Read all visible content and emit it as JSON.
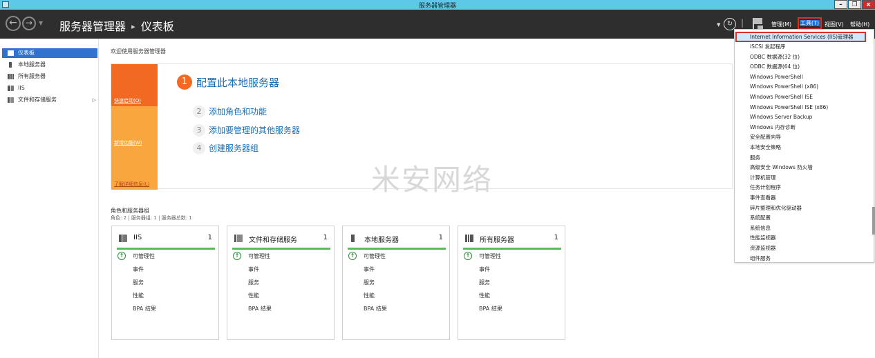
{
  "window": {
    "title": "服务器管理器",
    "min_glyph": "–",
    "max_glyph": "❐",
    "close_glyph": "x"
  },
  "header": {
    "back_glyph": "←",
    "forward_glyph": "→",
    "dropdown_glyph": "▼",
    "breadcrumb_root": "服务器管理器",
    "breadcrumb_sep": "▸",
    "breadcrumb_current": "仪表板",
    "refresh_glyph": "↻",
    "separator": "|",
    "menus": {
      "manage": "管理(M)",
      "tools": "工具(T)",
      "view": "视图(V)",
      "help": "帮助(H)"
    }
  },
  "sidebar": {
    "items": [
      {
        "label": "仪表板",
        "icon": "dashboard-grid-icon",
        "selected": true
      },
      {
        "label": "本地服务器",
        "icon": "server-icon"
      },
      {
        "label": "所有服务器",
        "icon": "servers-icon"
      },
      {
        "label": "IIS",
        "icon": "iis-icon"
      },
      {
        "label": "文件和存储服务",
        "icon": "file-storage-icon",
        "arrow": "▷"
      }
    ]
  },
  "main": {
    "welcome": "欢迎使用服务器管理器",
    "quickstart": {
      "tiles": [
        "快速启动(Q)",
        "新增功能(W)",
        "了解详细信息(L)"
      ],
      "steps": [
        {
          "num": "1",
          "label": "配置此本地服务器"
        },
        {
          "num": "2",
          "label": "添加角色和功能"
        },
        {
          "num": "3",
          "label": "添加要管理的其他服务器"
        },
        {
          "num": "4",
          "label": "创建服务器组"
        }
      ]
    },
    "watermark": "米安网络",
    "roles": {
      "title": "角色和服务器组",
      "subtitle": "角色: 2 | 服务器组: 1 | 服务器总数: 1",
      "cards": [
        {
          "title": "IIS",
          "count": "1",
          "ok_glyph": "↑",
          "lines": [
            "可管理性",
            "事件",
            "服务",
            "性能",
            "BPA 结果"
          ]
        },
        {
          "title": "文件和存储服务",
          "count": "1",
          "ok_glyph": "↑",
          "lines": [
            "可管理性",
            "事件",
            "服务",
            "性能",
            "BPA 结果"
          ]
        },
        {
          "title": "本地服务器",
          "count": "1",
          "ok_glyph": "↑",
          "lines": [
            "可管理性",
            "事件",
            "服务",
            "性能",
            "BPA 结果"
          ]
        },
        {
          "title": "所有服务器",
          "count": "1",
          "ok_glyph": "↑",
          "lines": [
            "可管理性",
            "事件",
            "服务",
            "性能",
            "BPA 结果"
          ]
        }
      ]
    }
  },
  "tools_menu": {
    "items": [
      "Internet Information Services (IIS)管理器",
      "iSCSI 发起程序",
      "ODBC 数据源(32 位)",
      "ODBC 数据源(64 位)",
      "Windows PowerShell",
      "Windows PowerShell (x86)",
      "Windows PowerShell ISE",
      "Windows PowerShell ISE (x86)",
      "Windows Server Backup",
      "Windows 内存诊断",
      "安全配置向导",
      "本地安全策略",
      "服务",
      "高级安全 Windows 防火墙",
      "计算机管理",
      "任务计划程序",
      "事件查看器",
      "碎片整理和优化驱动器",
      "系统配置",
      "系统信息",
      "性能监视器",
      "资源监视器",
      "组件服务"
    ]
  },
  "colors": {
    "titlebar": "#5ec8e8",
    "header": "#2e2e2e",
    "accent_orange": "#f26a22",
    "tile_light": "#f8a73e",
    "link_blue": "#1a6fb7",
    "selection_blue": "#2f73cf",
    "status_green": "#5cb85c",
    "highlight_red": "#d9302c"
  }
}
